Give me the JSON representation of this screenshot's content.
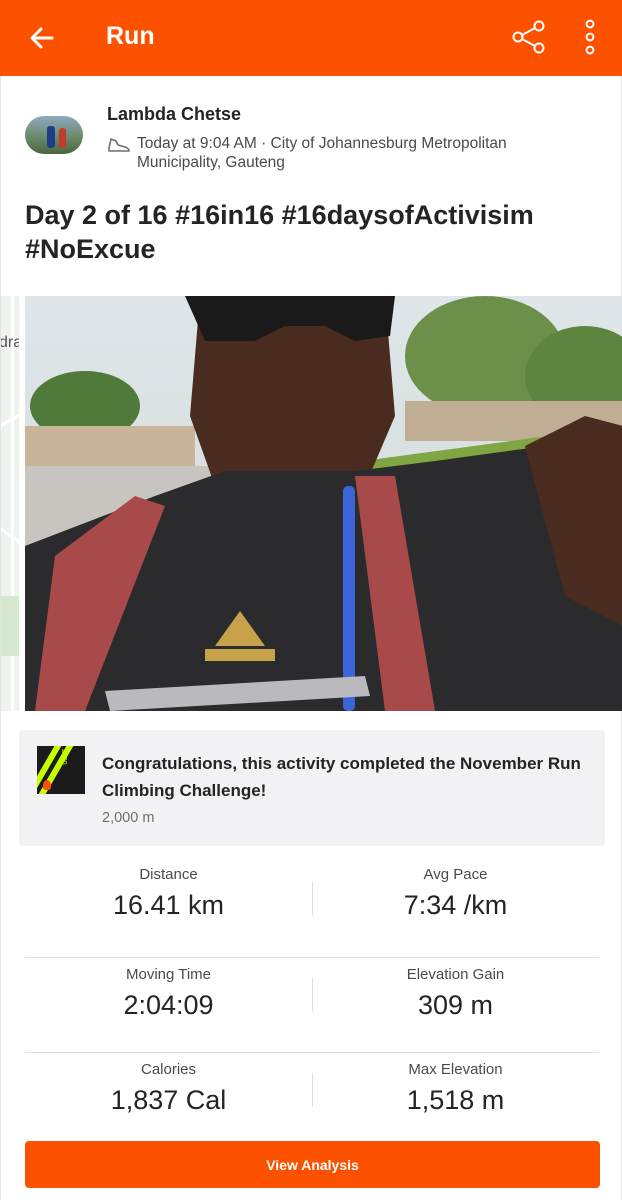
{
  "header": {
    "title": "Run",
    "back_icon": "arrow-left-icon",
    "share_icon": "share-icon",
    "more_icon": "more-vertical-icon",
    "background_color": "#fc5200"
  },
  "athlete": {
    "name": "Lambda Chetse",
    "activity_icon": "shoe-icon",
    "meta": "Today at 9:04 AM · City of Johannesburg Metropolitan Municipality, Gauteng"
  },
  "activity": {
    "title": "Day 2 of 16 #16in16 #16daysofActivisim #NoExcue"
  },
  "map_peek": {
    "label": "dra"
  },
  "achievement": {
    "badge_text": "2000",
    "text": "Congratulations, this activity completed the November Run Climbing Challenge!",
    "subtext": "2,000 m"
  },
  "stats": [
    {
      "label": "Distance",
      "value": "16.41 km"
    },
    {
      "label": "Avg Pace",
      "value": "7:34 /km"
    },
    {
      "label": "Moving Time",
      "value": "2:04:09"
    },
    {
      "label": "Elevation Gain",
      "value": "309 m"
    },
    {
      "label": "Calories",
      "value": "1,837 Cal"
    },
    {
      "label": "Max Elevation",
      "value": "1,518 m"
    }
  ],
  "actions": {
    "view_analysis": "View Analysis"
  }
}
